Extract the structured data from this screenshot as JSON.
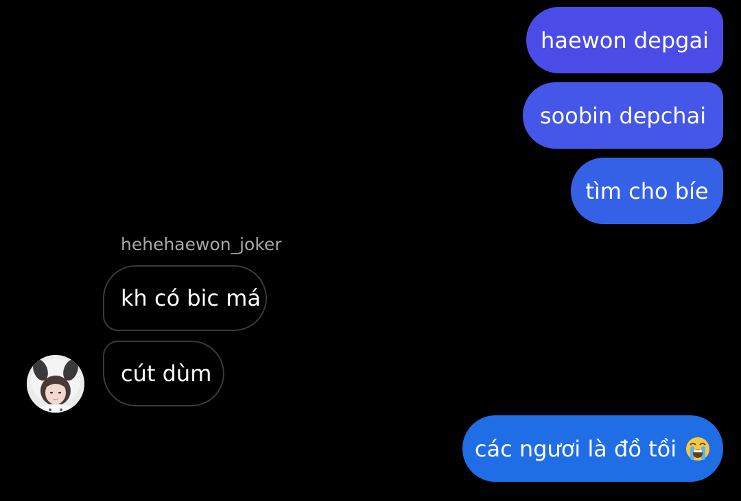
{
  "chat": {
    "outgoing": [
      {
        "text": "haewon depgai"
      },
      {
        "text": "soobin depchai"
      },
      {
        "text": "tìm cho bíe"
      },
      {
        "text": "các ngươi là đồ tồi",
        "emoji": "loudly-crying-face-icon"
      }
    ],
    "incoming": {
      "sender_name": "hehehaewon_joker",
      "messages": [
        {
          "text": "kh có bic má"
        },
        {
          "text": "cút dùm"
        }
      ],
      "avatar": "avatar-girl-bunny-hood"
    }
  },
  "colors": {
    "background": "#000000",
    "outgoing_bubble_1": "#4b4ce8",
    "outgoing_bubble_2": "#4457e8",
    "outgoing_bubble_3": "#3461e6",
    "outgoing_bubble_4": "#1f6ee6",
    "incoming_border": "#3a3a3a",
    "sender_name": "#a8a8a8"
  }
}
